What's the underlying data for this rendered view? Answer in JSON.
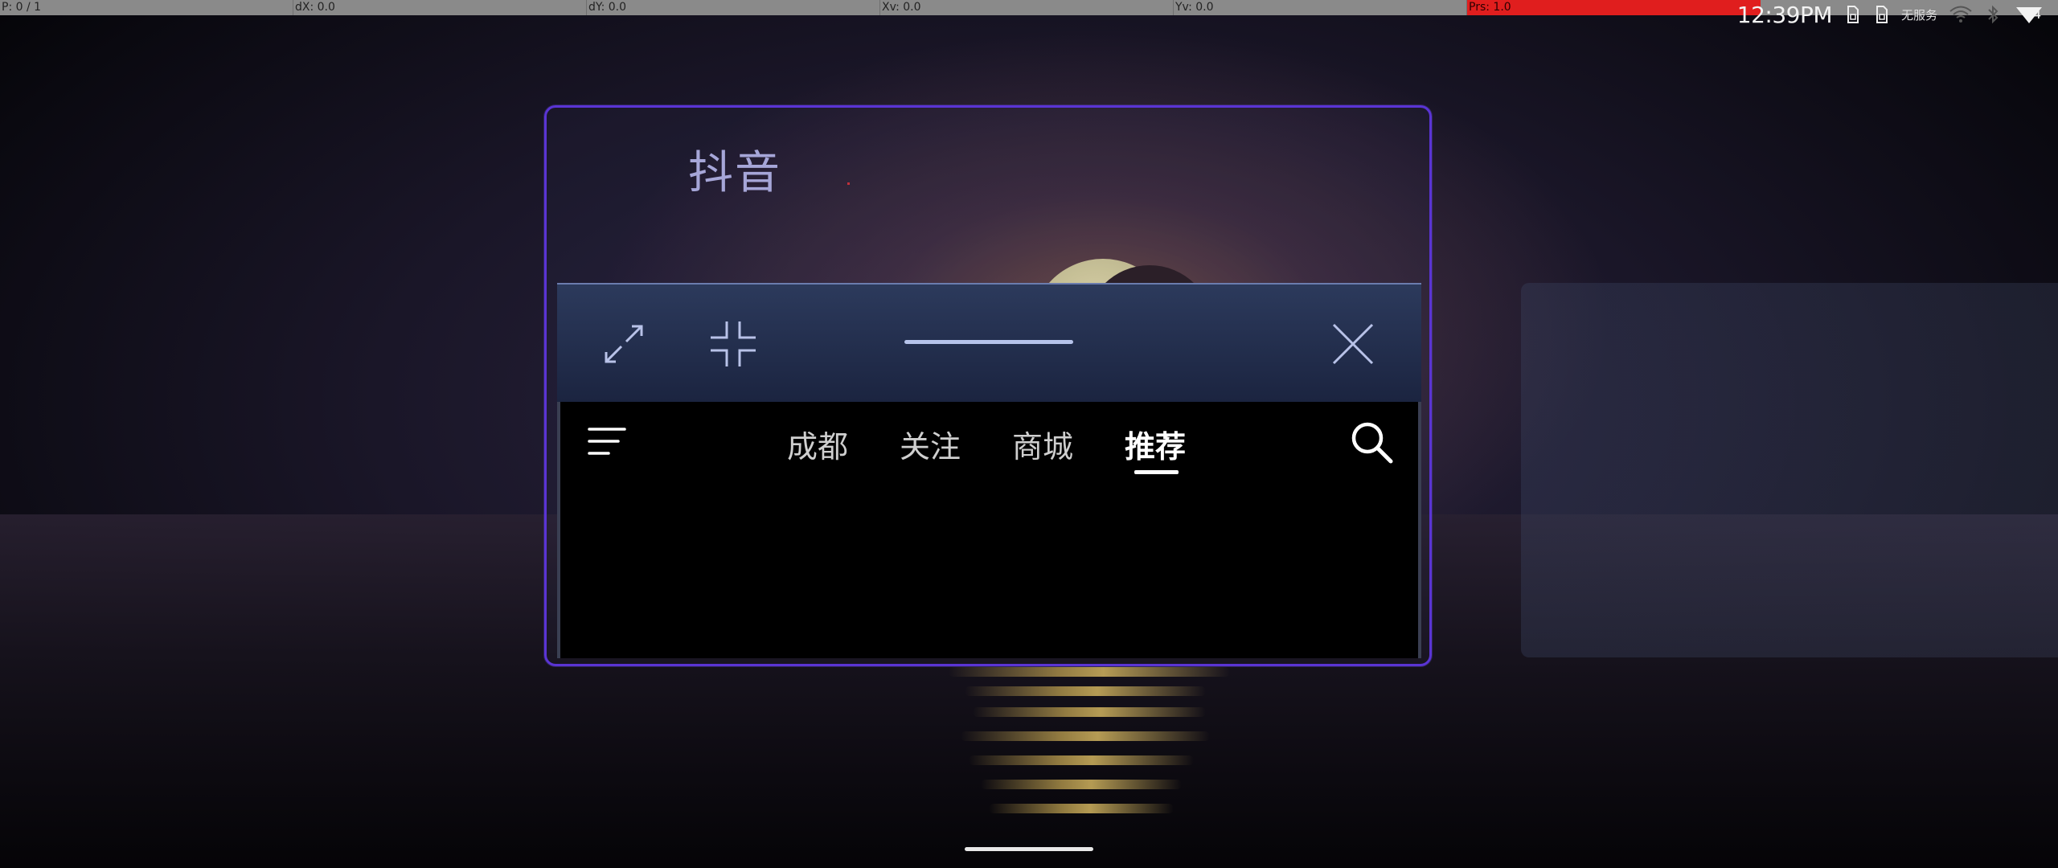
{
  "pointer_bar": {
    "p": "P: 0 / 1",
    "dx": "dX: 0.0",
    "dy": "dY: 0.0",
    "xv": "Xv: 0.0",
    "yv": "Yv: 0.0",
    "prs": "Prs: 1.0",
    "prs_color": "#e01e1e"
  },
  "status_bar": {
    "time": "12:39PM",
    "carrier": "无服务",
    "battery": "4",
    "icons": [
      "sim-icon",
      "sim-icon",
      "wifi-icon",
      "bluetooth-icon",
      "battery-icon"
    ]
  },
  "floating_window": {
    "app_name": "抖音",
    "border_color": "#5a34d4",
    "controls": {
      "maximize_icon": "maximize-icon",
      "minimize_icon": "minimize-icon",
      "close_icon": "close-icon"
    }
  },
  "top_tabs": {
    "menu_icon": "menu-icon",
    "search_icon": "search-icon",
    "items": [
      {
        "label": "成都"
      },
      {
        "label": "关注"
      },
      {
        "label": "商城"
      },
      {
        "label": "推荐"
      }
    ],
    "active_index": 3
  }
}
